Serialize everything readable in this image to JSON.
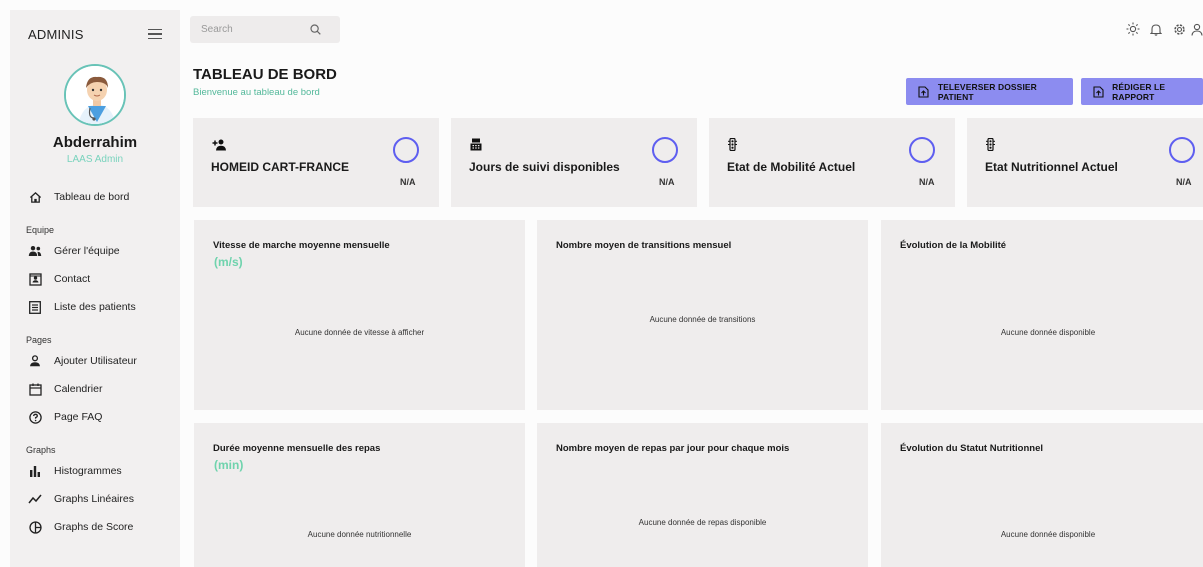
{
  "sidebar": {
    "brand": "ADMINIS",
    "user": {
      "name": "Abderrahim",
      "role": "LAAS Admin"
    },
    "dashboard_label": "Tableau de bord",
    "sections": [
      {
        "title": "Equipe",
        "items": [
          {
            "label": "Gérer l'équipe",
            "icon": "team-icon"
          },
          {
            "label": "Contact",
            "icon": "contact-card-icon"
          },
          {
            "label": "Liste des patients",
            "icon": "list-icon"
          }
        ]
      },
      {
        "title": "Pages",
        "items": [
          {
            "label": "Ajouter Utilisateur",
            "icon": "user-icon"
          },
          {
            "label": "Calendrier",
            "icon": "calendar-icon"
          },
          {
            "label": "Page FAQ",
            "icon": "help-icon"
          }
        ]
      },
      {
        "title": "Graphs",
        "items": [
          {
            "label": "Histogrammes",
            "icon": "bar-chart-icon"
          },
          {
            "label": "Graphs Linéaires",
            "icon": "line-chart-icon"
          },
          {
            "label": "Graphs de Score",
            "icon": "pie-chart-icon"
          }
        ]
      }
    ]
  },
  "search": {
    "placeholder": "Search"
  },
  "header": {
    "title": "TABLEAU DE BORD",
    "subtitle": "Bienvenue au tableau de bord",
    "upload_label": "TELEVERSER DOSSIER PATIENT",
    "report_label": "RÉDIGER LE RAPPORT"
  },
  "stats": [
    {
      "label": "HOMEID CART-FRANCE",
      "value": "N/A",
      "icon": "person-add-icon"
    },
    {
      "label": "Jours de suivi disponibles",
      "value": "N/A",
      "icon": "register-icon"
    },
    {
      "label": "Etat de Mobilité Actuel",
      "value": "N/A",
      "icon": "traffic-icon"
    },
    {
      "label": "Etat Nutritionnel Actuel",
      "value": "N/A",
      "icon": "traffic-icon"
    }
  ],
  "panels": [
    {
      "title": "Vitesse de marche moyenne mensuelle",
      "unit": "(m/s)",
      "empty": "Aucune donnée de vitesse à afficher"
    },
    {
      "title": "Nombre moyen de transitions mensuel",
      "unit": "",
      "empty": "Aucune donnée de transitions"
    },
    {
      "title": "Évolution de la Mobilité",
      "unit": "",
      "empty": "Aucune donnée disponible"
    },
    {
      "title": "Durée moyenne mensuelle des repas",
      "unit": "(min)",
      "empty": "Aucune donnée nutritionnelle"
    },
    {
      "title": "Nombre moyen de repas par jour pour chaque mois",
      "unit": "",
      "empty": "Aucune donnée de repas disponible"
    },
    {
      "title": "Évolution du Statut Nutritionnel",
      "unit": "",
      "empty": "Aucune donnée disponible"
    }
  ],
  "colors": {
    "accent": "#8c8cf0",
    "ring": "#5e5ef0",
    "green": "#6fd3ad",
    "sidebar_bg": "#f2f0f0",
    "card_bg": "#efeded"
  }
}
